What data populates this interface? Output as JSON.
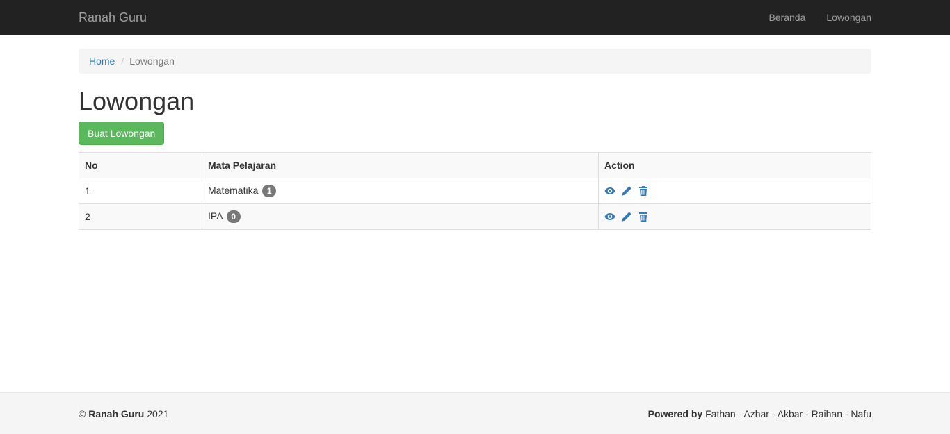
{
  "navbar": {
    "brand": "Ranah Guru",
    "links": [
      "Beranda",
      "Lowongan"
    ]
  },
  "breadcrumb": {
    "home": "Home",
    "separator": "/",
    "current": "Lowongan"
  },
  "page": {
    "title": "Lowongan",
    "create_button": "Buat Lowongan"
  },
  "table": {
    "headers": [
      "No",
      "Mata Pelajaran",
      "Action"
    ],
    "rows": [
      {
        "no": "1",
        "subject": "Matematika",
        "count": "1"
      },
      {
        "no": "2",
        "subject": "IPA",
        "count": "0"
      }
    ],
    "action_icons": [
      "eye-icon",
      "pencil-icon",
      "trash-icon"
    ]
  },
  "footer": {
    "copyright_symbol": "©",
    "brand": "Ranah Guru",
    "year": "2021",
    "powered_label": "Powered by",
    "authors": "Fathan - Azhar - Akbar - Raihan - Nafu"
  },
  "colors": {
    "navbar_bg": "#222222",
    "link": "#337ab7",
    "success": "#5cb85c",
    "badge": "#777777"
  }
}
